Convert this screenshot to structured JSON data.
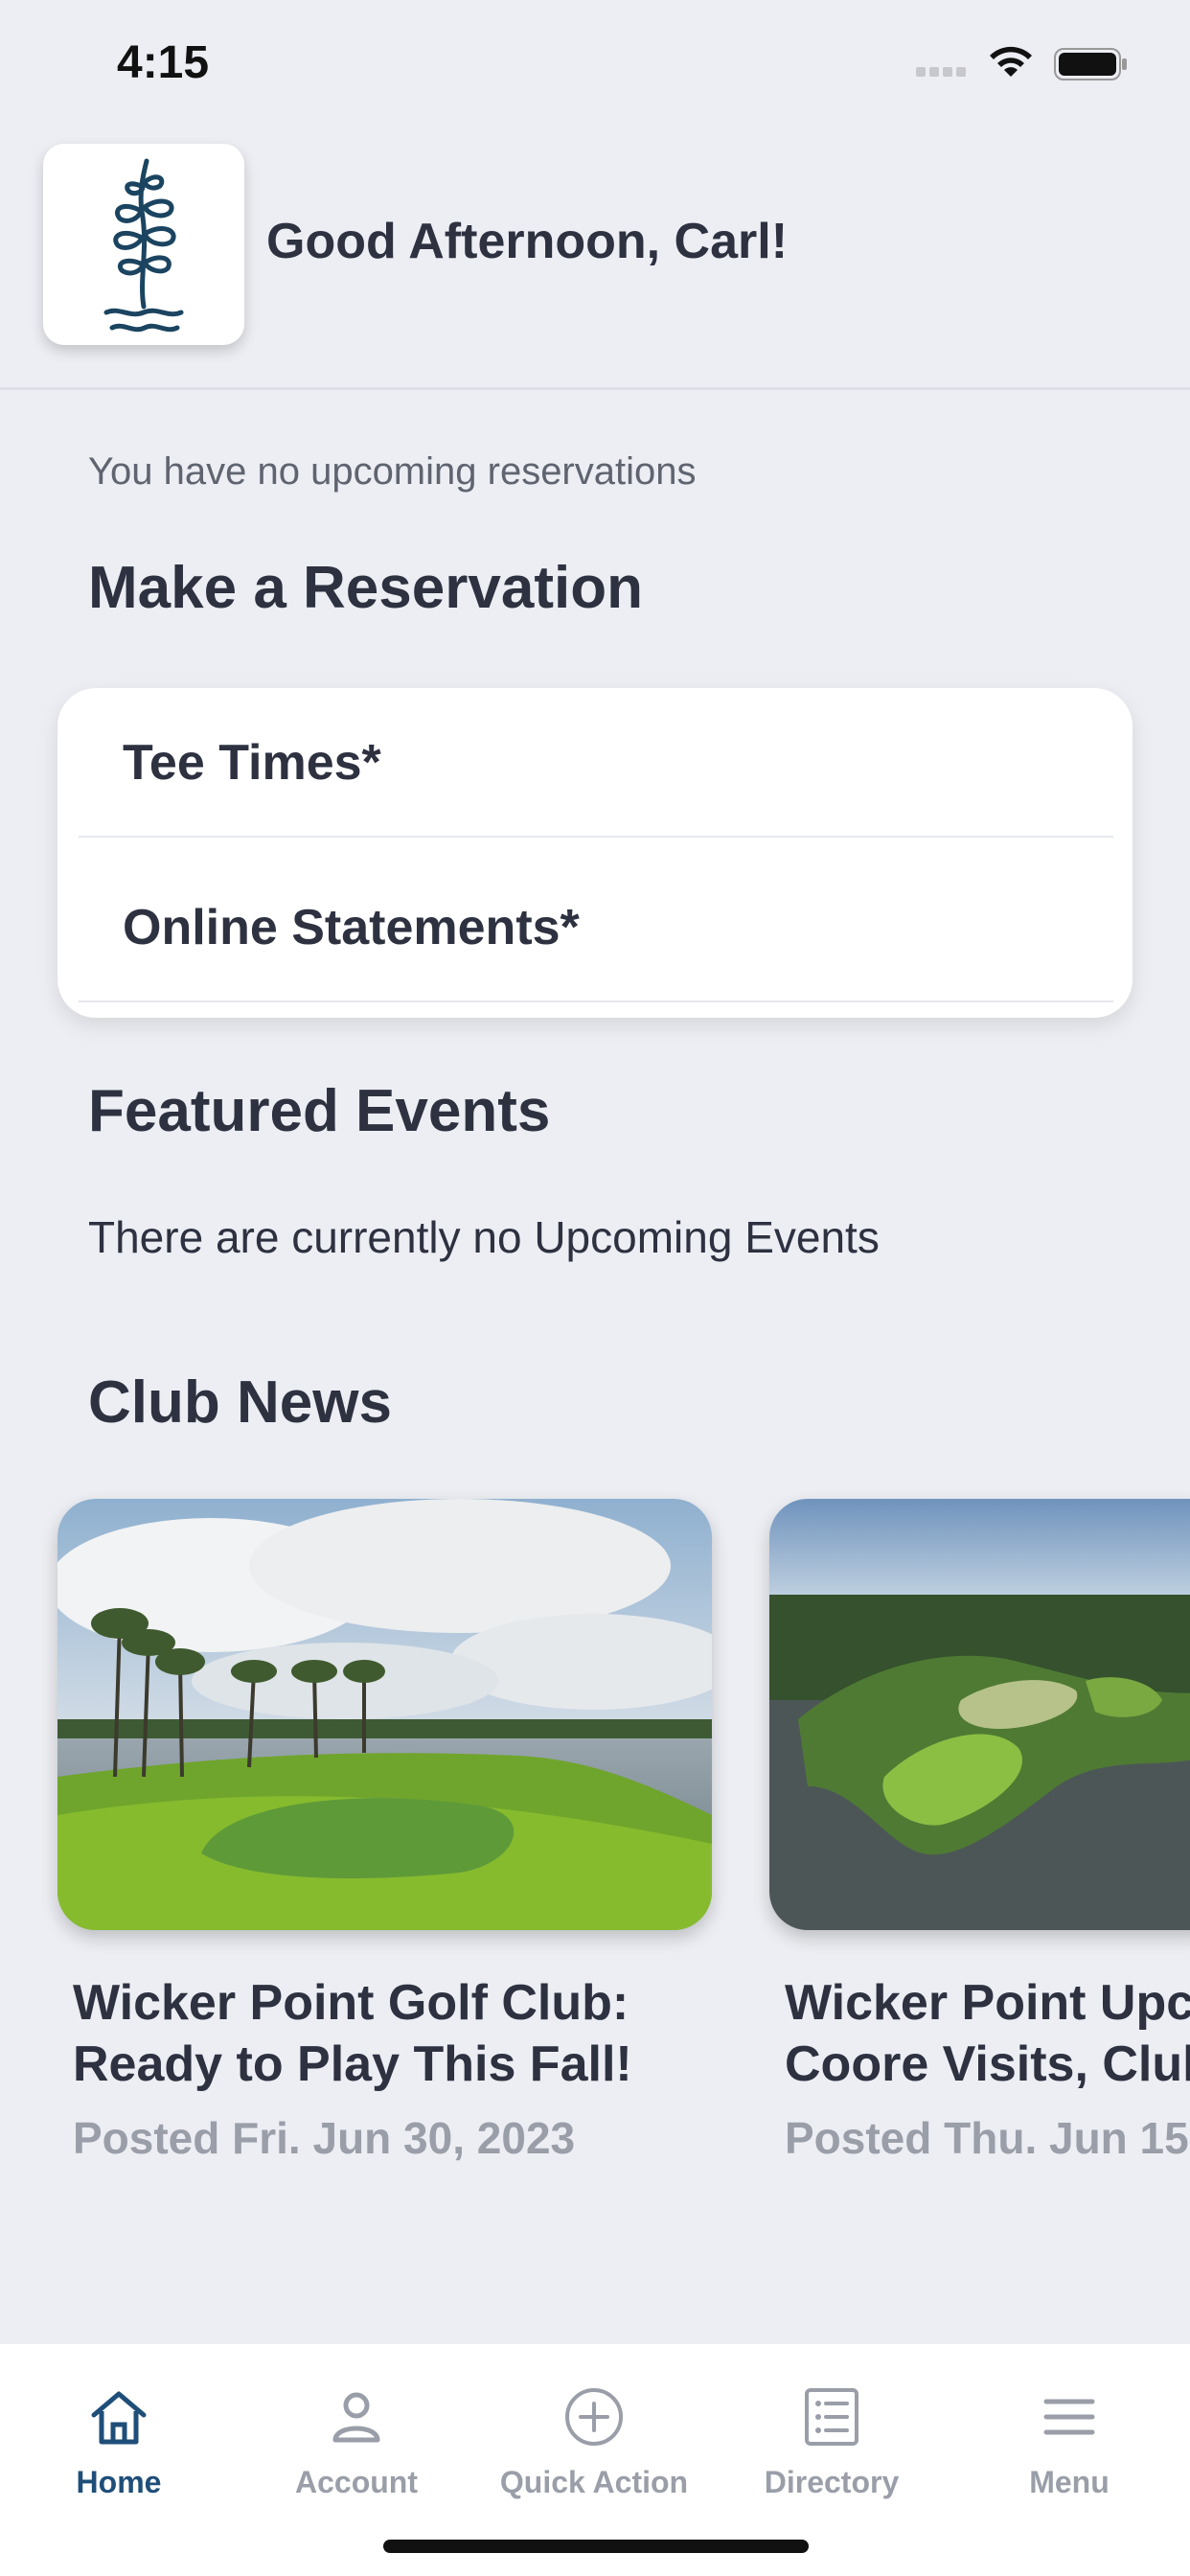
{
  "status_bar": {
    "time": "4:15"
  },
  "header": {
    "greeting": "Good Afternoon, Carl!"
  },
  "reservations": {
    "empty_text": "You have no upcoming reservations",
    "title": "Make a Reservation",
    "items": [
      "Tee Times*",
      "Online Statements*"
    ]
  },
  "events": {
    "title": "Featured Events",
    "empty_text": "There are currently no Upcoming Events"
  },
  "news": {
    "title": "Club News",
    "items": [
      {
        "title_line1": "Wicker Point Golf Club:",
        "title_line2": "Ready to Play This Fall!",
        "date": "Posted Fri. Jun 30, 2023"
      },
      {
        "title_line1": "Wicker Point Upc",
        "title_line2": "Coore Visits, Clul",
        "date": "Posted Thu. Jun 15"
      }
    ]
  },
  "tabbar": {
    "items": [
      {
        "label": "Home",
        "icon": "home-icon",
        "active": true
      },
      {
        "label": "Account",
        "icon": "person-icon",
        "active": false
      },
      {
        "label": "Quick Action",
        "icon": "plus-circle-icon",
        "active": false
      },
      {
        "label": "Directory",
        "icon": "list-icon",
        "active": false
      },
      {
        "label": "Menu",
        "icon": "hamburger-icon",
        "active": false
      }
    ]
  },
  "colors": {
    "accent": "#1f4e79",
    "background": "#eceef3",
    "text": "#2d3140",
    "muted": "#9a9ea8"
  }
}
